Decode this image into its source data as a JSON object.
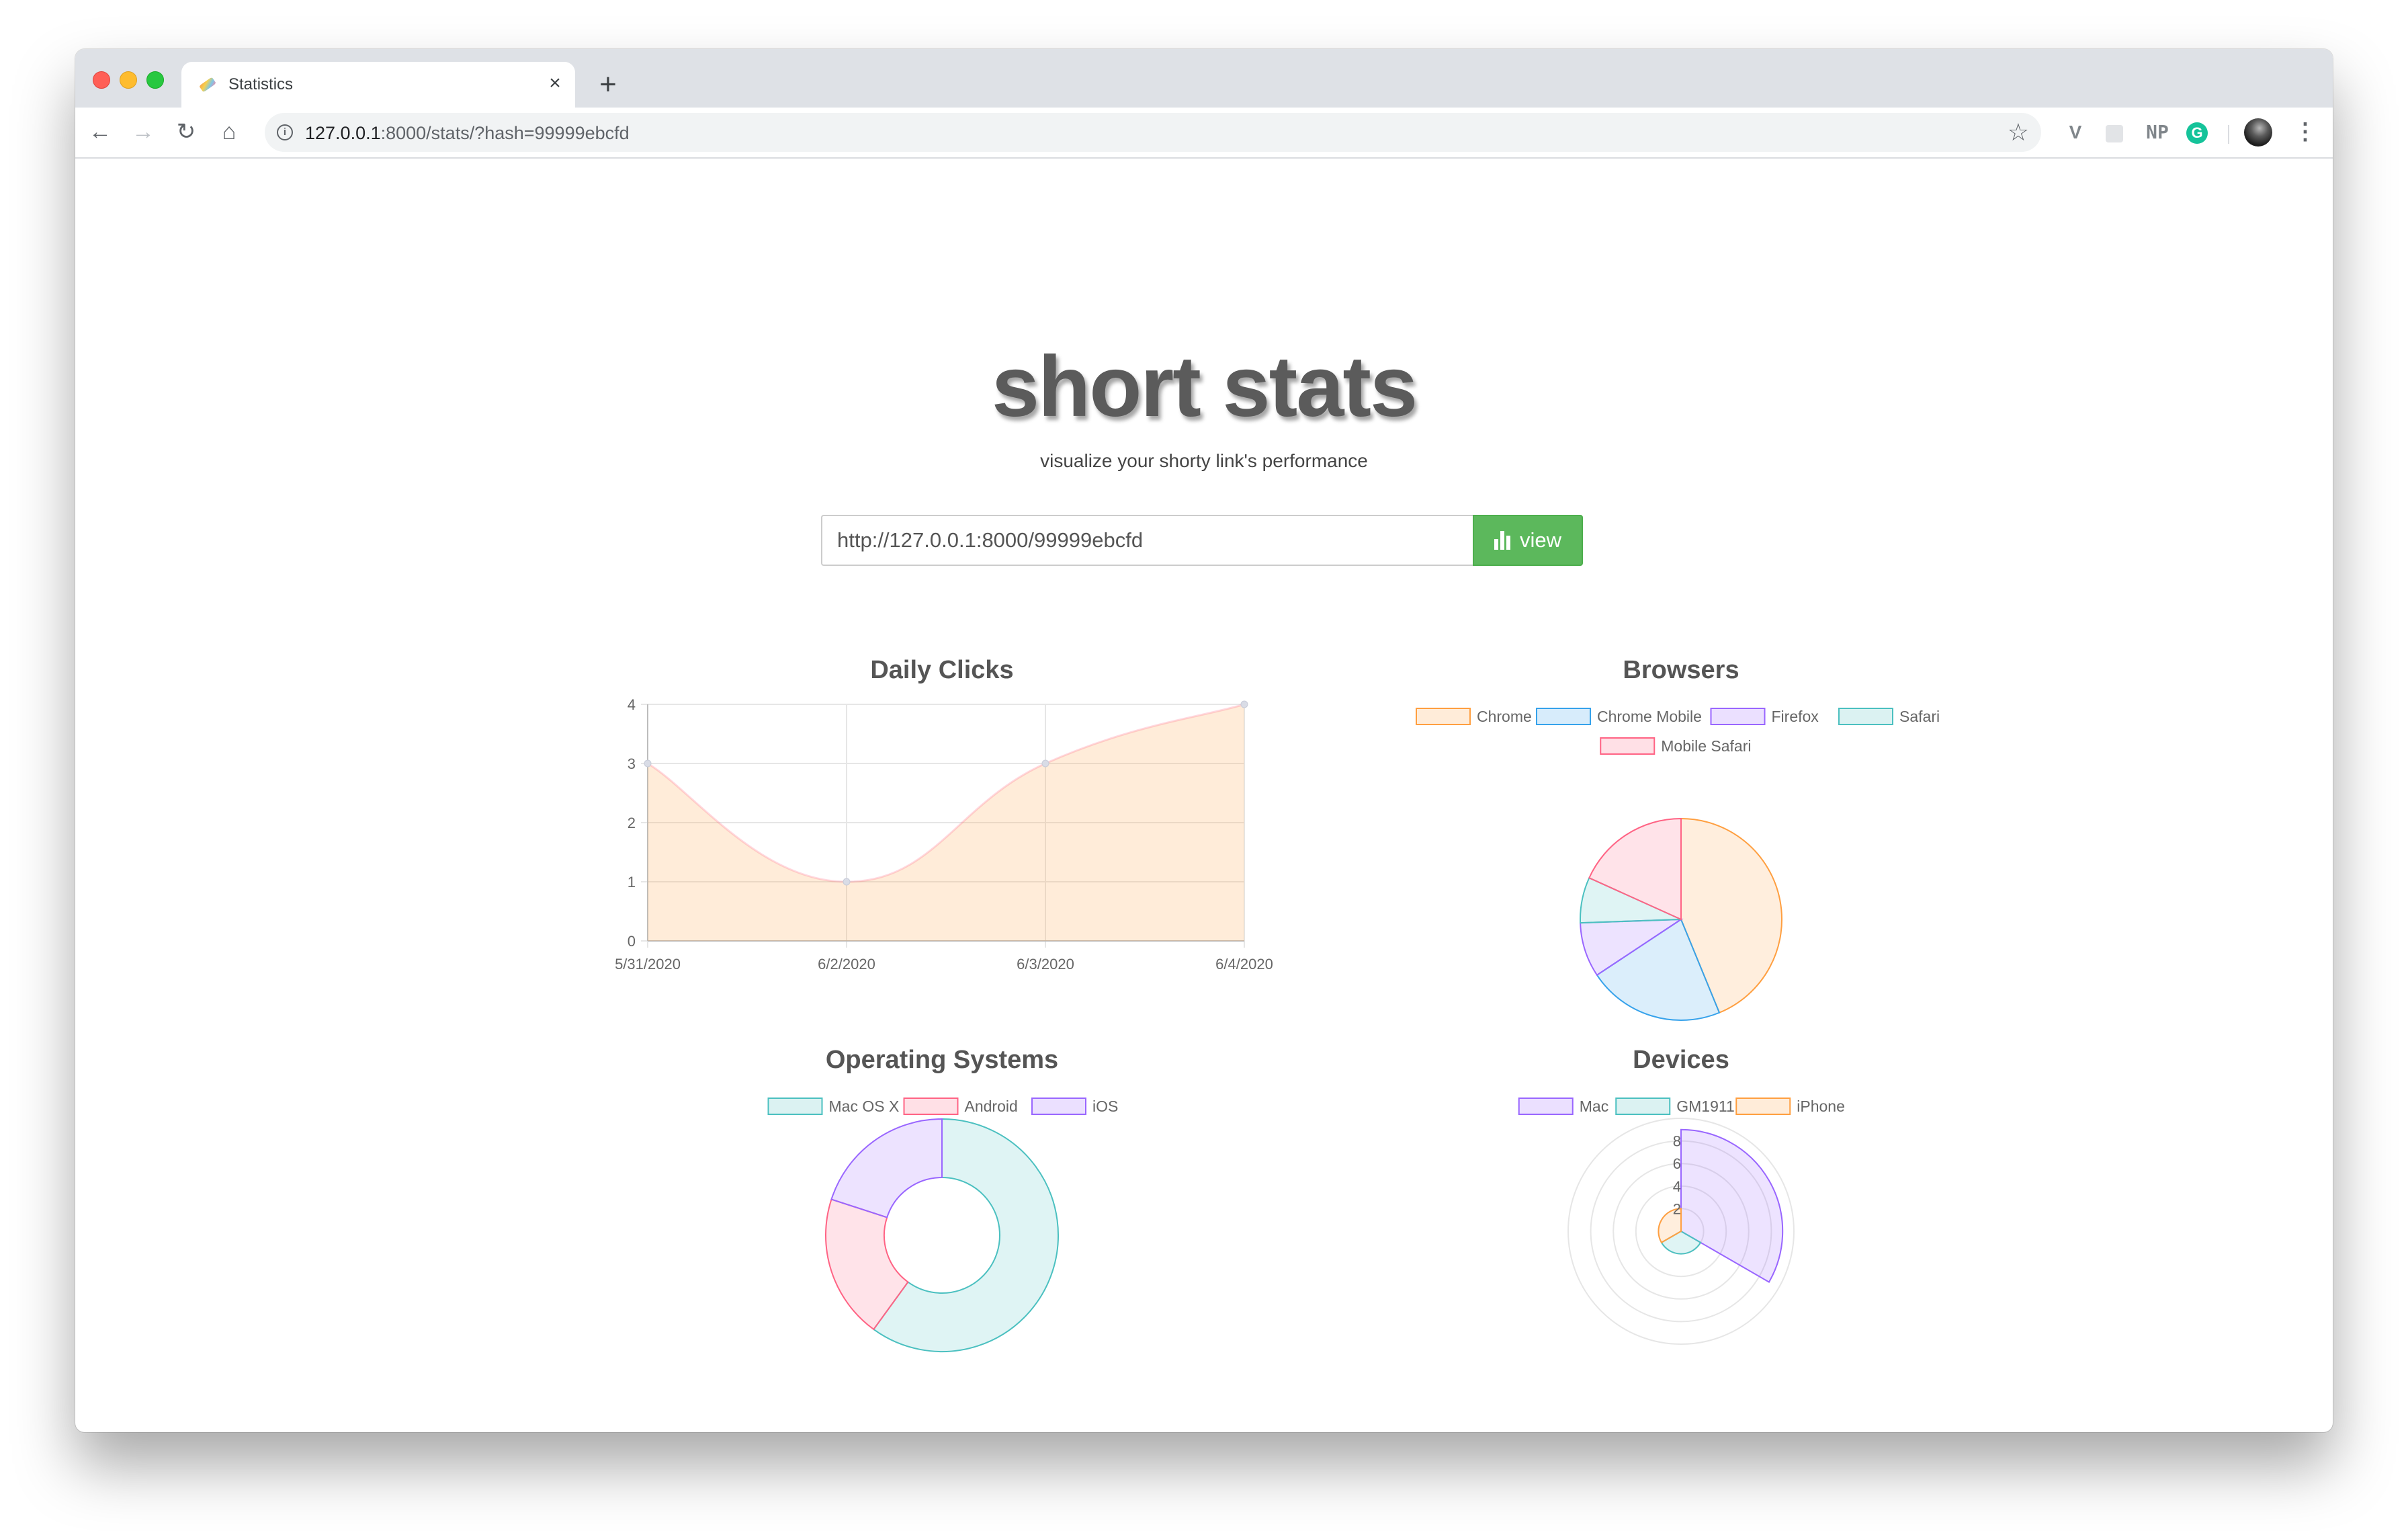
{
  "browser": {
    "tab_title": "Statistics",
    "tab_close": "×",
    "new_tab": "+",
    "url_host": "127.0.0.1",
    "url_rest": ":8000/stats/?hash=99999ebcfd",
    "extensions": {
      "v": "V",
      "np": "NP",
      "g": "G"
    }
  },
  "hero": {
    "title": "short stats",
    "subtitle": "visualize your shorty link's performance"
  },
  "search": {
    "value": "http://127.0.0.1:8000/99999ebcfd",
    "button_label": "view"
  },
  "colors": {
    "orange": "#ff9f40",
    "blue": "#36a2eb",
    "purple": "#9966ff",
    "teal": "#4bc0c0",
    "pink": "#ff6384",
    "button": "#5cb85c",
    "title": "#5b5b5b"
  },
  "chart_data": [
    {
      "type": "area",
      "title": "Daily Clicks",
      "x": [
        "5/31/2020",
        "6/2/2020",
        "6/3/2020",
        "6/4/2020"
      ],
      "series": [
        {
          "values": [
            3,
            1,
            3,
            4
          ],
          "color": "#ff9f40"
        }
      ],
      "yticks": [
        "0",
        "1",
        "2",
        "3",
        "4"
      ],
      "ylim": [
        0,
        4
      ],
      "grid": true
    },
    {
      "type": "pie",
      "title": "Browsers",
      "legend": "top",
      "labels": [
        "Chrome",
        "Chrome Mobile",
        "Firefox",
        "Safari",
        "Mobile Safari"
      ],
      "values": [
        6,
        3,
        1.2,
        1,
        2.5
      ],
      "colors": [
        "#ff9f40",
        "#36a2eb",
        "#9966ff",
        "#4bc0c0",
        "#ff6384"
      ]
    },
    {
      "type": "doughnut",
      "title": "Operating Systems",
      "legend": "top",
      "labels": [
        "Mac OS X",
        "Android",
        "iOS"
      ],
      "values": [
        9,
        3,
        3
      ],
      "colors": [
        "#4bc0c0",
        "#ff6384",
        "#9966ff"
      ]
    },
    {
      "type": "polarArea",
      "title": "Devices",
      "legend": "top",
      "labels": [
        "Mac",
        "GM1911",
        "iPhone"
      ],
      "values": [
        9,
        2,
        2
      ],
      "rticks": [
        "2",
        "4",
        "6",
        "8"
      ],
      "rlim": [
        0,
        10
      ],
      "colors": [
        "#9966ff",
        "#4bc0c0",
        "#ff9f40"
      ]
    }
  ]
}
